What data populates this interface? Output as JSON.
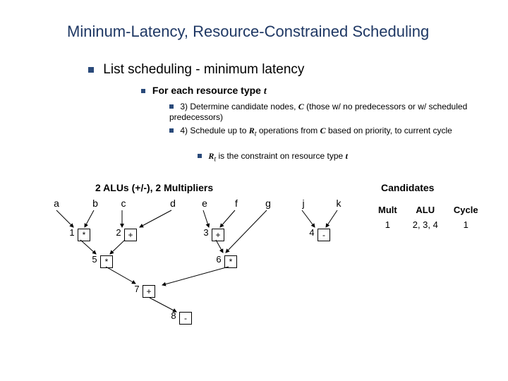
{
  "title": "Mininum-Latency, Resource-Constrained Scheduling",
  "h1": "List scheduling - minimum latency",
  "l2_pre": "For each resource type ",
  "l2_var": "t",
  "l3a_pre": "3) Determine candidate nodes, ",
  "l3a_c": "C",
  "l3a_rest": " (those w/ no predecessors or w/ scheduled predecessors)",
  "l3b_pre": "4) Schedule up to ",
  "l3b_r": "R",
  "l3b_sub": "t",
  "l3b_mid": " operations from ",
  "l3b_c": "C",
  "l3b_rest": " based on priority, to current cycle",
  "l4_r": "R",
  "l4_sub": "t",
  "l4_mid": " is the constraint on resource type ",
  "l4_t": "t",
  "resources_label": "2 ALUs (+/-), 2 Multipliers",
  "candidates_label": "Candidates",
  "table": {
    "headers": [
      "Mult",
      "ALU",
      "Cycle"
    ],
    "row": [
      "1",
      "2, 3, 4",
      "1"
    ]
  },
  "cols": [
    "a",
    "b",
    "c",
    "d",
    "e",
    "f",
    "g",
    "j",
    "k"
  ],
  "nodes": {
    "n1": {
      "num": "1",
      "op": "*"
    },
    "n2": {
      "num": "2",
      "op": "+"
    },
    "n3": {
      "num": "3",
      "op": "+"
    },
    "n4": {
      "num": "4",
      "op": "-"
    },
    "n5": {
      "num": "5",
      "op": "*"
    },
    "n6": {
      "num": "6",
      "op": "*"
    },
    "n7": {
      "num": "7",
      "op": "+"
    },
    "n8": {
      "num": "8",
      "op": "-"
    }
  }
}
